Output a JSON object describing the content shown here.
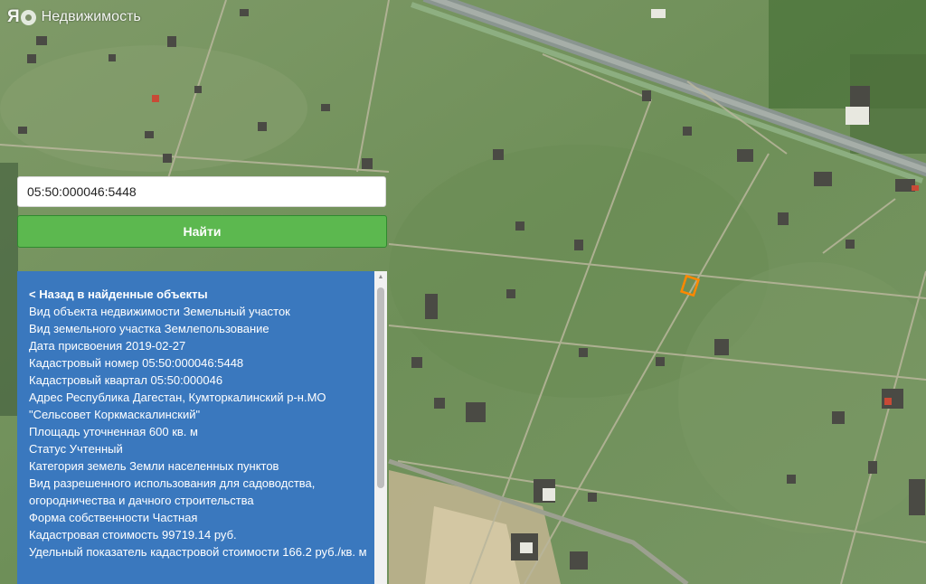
{
  "brand": {
    "logo_letter": "Я",
    "name": "Недвижимость"
  },
  "search": {
    "value": "05:50:000046:5448",
    "button_label": "Найти"
  },
  "info_panel": {
    "back_label": "< Назад в найденные объекты",
    "fields": [
      {
        "key": "Вид объекта недвижимости",
        "value": "Земельный участок"
      },
      {
        "key": "Вид земельного участка",
        "value": "Землепользование"
      },
      {
        "key": "Дата присвоения",
        "value": "2019-02-27"
      },
      {
        "key": "Кадастровый номер",
        "value": "05:50:000046:5448"
      },
      {
        "key": "Кадастровый квартал",
        "value": "05:50:000046"
      },
      {
        "key": "Адрес",
        "value": "Республика Дагестан, Кумторкалинский р-н.МО \"Сельсовет Коркмаскалинский\""
      },
      {
        "key": "Площадь уточненная",
        "value": "600 кв. м"
      },
      {
        "key": "Статус",
        "value": "Учтенный"
      },
      {
        "key": "Категория земель",
        "value": "Земли населенных пунктов"
      },
      {
        "key": "Вид разрешенного использования",
        "value": "для садоводства, огородничества и дачного строительства"
      },
      {
        "key": "Форма собственности",
        "value": "Частная"
      },
      {
        "key": "Кадастровая стоимость",
        "value": "99719.14 руб."
      },
      {
        "key": "Удельный показатель кадастровой стоимости",
        "value": "166.2 руб./кв. м"
      }
    ]
  },
  "colors": {
    "panel_bg": "#3a78be",
    "button_bg": "#5cb84f",
    "parcel_outline": "#ff8800",
    "terrain": "#6e8f58"
  },
  "icons": {
    "brand_logo": "yandex-logo-icon",
    "brand_mark": "brand-circle-icon"
  }
}
